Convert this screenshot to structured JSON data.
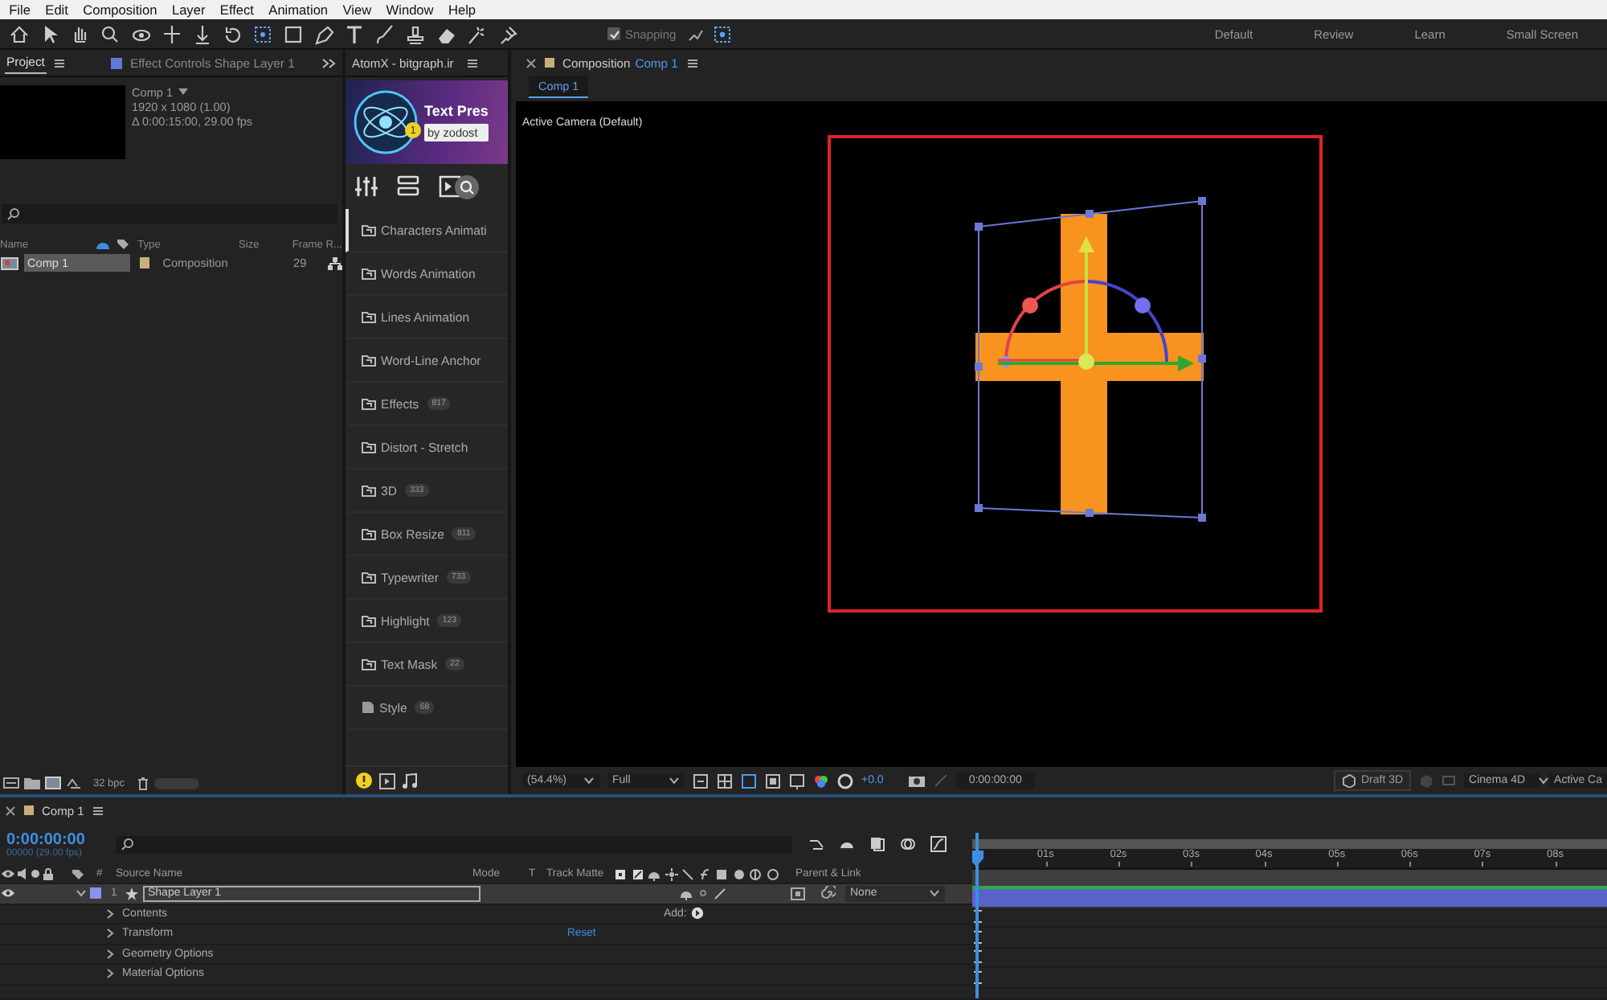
{
  "menu": [
    "File",
    "Edit",
    "Composition",
    "Layer",
    "Effect",
    "Animation",
    "View",
    "Window",
    "Help"
  ],
  "toolbar": {
    "snapping": {
      "label": "Snapping",
      "checked": true
    },
    "workspaces": [
      "Default",
      "Review",
      "Learn",
      "Small Screen"
    ]
  },
  "project_panel": {
    "tabs": [
      {
        "label": "Project",
        "selected": true
      },
      {
        "label": "Effect Controls Shape Layer 1",
        "selected": false
      }
    ],
    "comp_info": {
      "name": "Comp 1",
      "size": "1920 x 1080 (1.00)",
      "duration": "Δ 0:00:15:00, 29.00 fps"
    },
    "columns": [
      "Name",
      "Type",
      "Size",
      "Frame R..."
    ],
    "items": [
      {
        "name": "Comp 1",
        "type": "Composition",
        "frame_rate": "29",
        "selected": true
      }
    ],
    "bit_depth": "32 bpc"
  },
  "atomx_panel": {
    "title": "AtomX - bitgraph.ir",
    "banner": {
      "title": "Text Pres",
      "byline": "by zodost",
      "badge": "1"
    },
    "categories": [
      {
        "label": "Characters Animati",
        "kind": "folder",
        "selected": true
      },
      {
        "label": "Words Animation",
        "kind": "folder",
        "selected": false
      },
      {
        "label": "Lines Animation",
        "kind": "folder",
        "selected": false
      },
      {
        "label": "Word-Line Anchor",
        "kind": "folder",
        "selected": false
      },
      {
        "label": "Effects",
        "count": "817",
        "kind": "folder",
        "selected": false
      },
      {
        "label": "Distort - Stretch",
        "kind": "folder",
        "selected": false
      },
      {
        "label": "3D",
        "count": "333",
        "kind": "folder",
        "selected": false
      },
      {
        "label": "Box Resize",
        "count": "811",
        "kind": "folder",
        "selected": false
      },
      {
        "label": "Typewriter",
        "count": "733",
        "kind": "folder",
        "selected": false
      },
      {
        "label": "Highlight",
        "count": "123",
        "kind": "folder",
        "selected": false
      },
      {
        "label": "Text Mask",
        "count": "22",
        "kind": "folder",
        "selected": false
      },
      {
        "label": "Style",
        "count": "68",
        "kind": "file",
        "selected": false
      }
    ]
  },
  "composition_panel": {
    "tab": {
      "label": "Composition",
      "name": "Comp 1"
    },
    "view_tab": "Comp 1",
    "camera_label": "Active Camera (Default)",
    "bottom_bar": {
      "zoom": "(54.4%)",
      "resolution": "Full",
      "exposure": "+0.0",
      "timecode": "0:00:00:00",
      "draft_button": "Draft 3D",
      "renderer": "Cinema 4D",
      "camera_view": "Active Ca"
    }
  },
  "timeline": {
    "tab": "Comp 1",
    "timecode": "0:00:00:00",
    "frame_info": "00000 (29.00 fps)",
    "columns": [
      "#",
      "Source Name",
      "Mode",
      "T",
      "Track Matte",
      "Parent & Link"
    ],
    "layers": [
      {
        "index": "1",
        "name": "Shape Layer 1",
        "visible": true,
        "expanded": true,
        "selected": true,
        "color": "#8a90f0",
        "parent": "None",
        "properties": [
          {
            "label": "Contents",
            "expanded": false,
            "action": "Add:"
          },
          {
            "label": "Transform",
            "expanded": false,
            "action": "Reset"
          },
          {
            "label": "Geometry Options",
            "expanded": false
          },
          {
            "label": "Material Options",
            "expanded": false
          }
        ]
      }
    ],
    "ruler": [
      "01s",
      "02s",
      "03s",
      "04s",
      "05s",
      "06s",
      "07s",
      "08s"
    ]
  }
}
